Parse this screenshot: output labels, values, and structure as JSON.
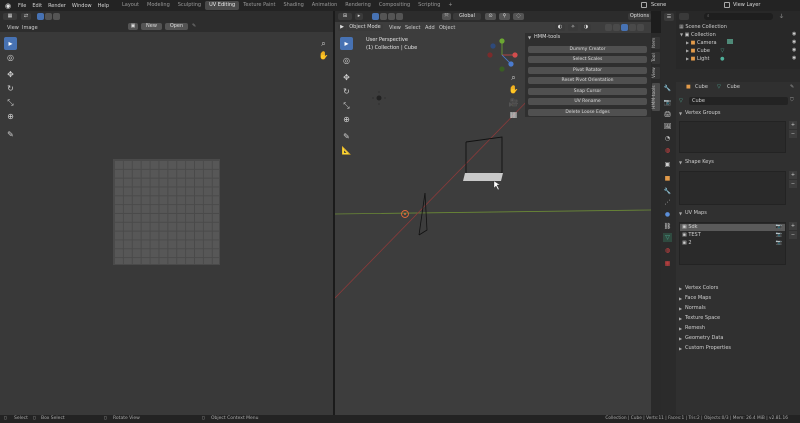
{
  "topbar": {
    "menus": [
      "File",
      "Edit",
      "Render",
      "Window",
      "Help"
    ],
    "workspaces": [
      "Layout",
      "Modeling",
      "Sculpting",
      "UV Editing",
      "Texture Paint",
      "Shading",
      "Animation",
      "Rendering",
      "Compositing",
      "Scripting"
    ],
    "active_workspace": "UV Editing",
    "scene_label": "Scene",
    "view_layer_label": "View Layer"
  },
  "uv_editor": {
    "menus": [
      "View",
      "Image"
    ],
    "new_label": "New",
    "open_label": "Open"
  },
  "viewport": {
    "mode_label": "Object Mode",
    "menus": [
      "View",
      "Select",
      "Add",
      "Object"
    ],
    "orientation_label": "Global",
    "options_label": "Options",
    "view_name": "User Perspective",
    "collection_info": "(1) Collection | Cube"
  },
  "hmm_tools": {
    "title": "HMM-tools",
    "buttons": [
      "Dummy Creator",
      "Select Scales",
      "Pivot Rotator",
      "Reset Pivot Orientation",
      "Snap Cursor",
      "UV Rename",
      "Delete Loose Edges"
    ]
  },
  "sidebar_tabs": [
    "Item",
    "Tool",
    "View",
    "HMM-tools"
  ],
  "outliner": {
    "search_placeholder": "",
    "rows": [
      {
        "label": "Scene Collection"
      },
      {
        "label": "Collection"
      },
      {
        "label": "Camera"
      },
      {
        "label": "Cube"
      },
      {
        "label": "Light"
      }
    ]
  },
  "properties": {
    "object_name": "Cube",
    "mesh_name": "Cube",
    "data_name": "Cube",
    "vertex_groups_label": "Vertex Groups",
    "shape_keys_label": "Shape Keys",
    "uv_maps_label": "UV Maps",
    "uv_maps": [
      "Sdk",
      "TEST",
      "2"
    ],
    "sections": [
      "Vertex Colors",
      "Face Maps",
      "Normals",
      "Texture Space",
      "Remesh",
      "Geometry Data",
      "Custom Properties"
    ]
  },
  "statusbar": {
    "select": "Select",
    "box_select": "Box Select",
    "rotate_view": "Rotate View",
    "context_menu": "Object Context Menu",
    "stats": "Collection | Cube | Verts:11 | Faces:1 | Tris:2 | Objects:0/3 | Mem: 26.4 MiB | v2.81.16"
  }
}
